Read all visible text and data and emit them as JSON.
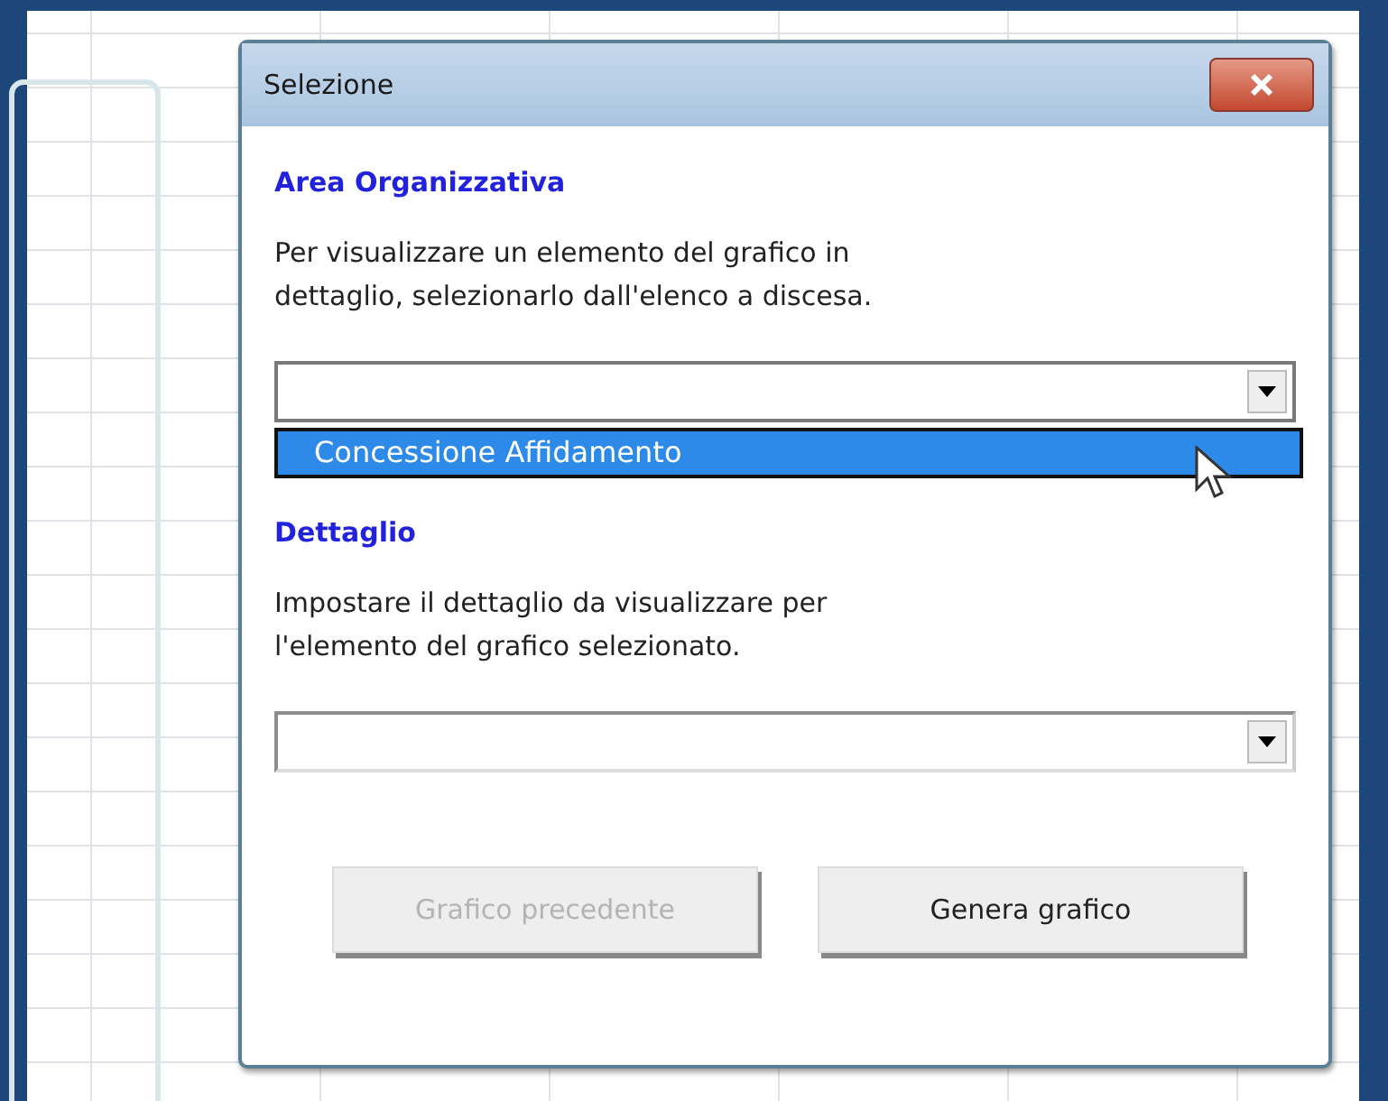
{
  "dialog": {
    "title": "Selezione",
    "sections": [
      {
        "heading": "Area Organizzativa",
        "description": "Per visualizzare un elemento del grafico in dettaglio, selezionarlo dall'elenco a discesa.",
        "combo": {
          "open": true,
          "items": [
            {
              "label": "Concessione Affidamento",
              "selected": true
            }
          ]
        }
      },
      {
        "heading": "Dettaglio",
        "description": "Impostare il dettaglio da visualizzare per l'elemento del grafico selezionato.",
        "combo": {
          "open": false
        }
      }
    ],
    "buttons": [
      {
        "label": "Grafico precedente",
        "disabled": true
      },
      {
        "label": "Genera grafico",
        "disabled": false
      }
    ]
  }
}
